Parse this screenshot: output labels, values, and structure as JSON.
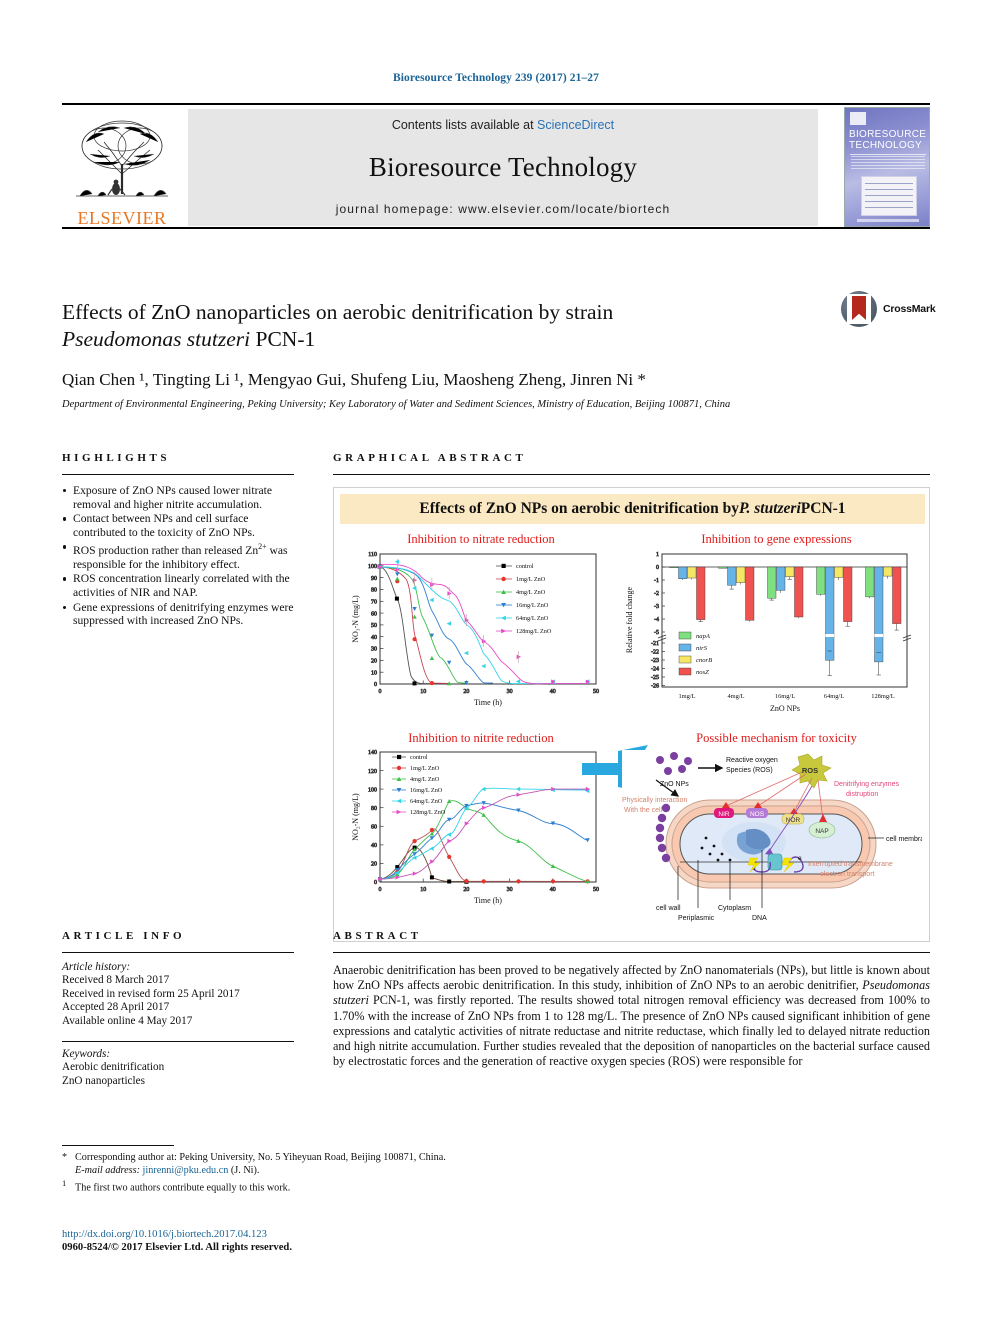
{
  "runhead": "Bioresource Technology 239 (2017) 21–27",
  "masthead": {
    "publisher": "ELSEVIER",
    "contents_prefix": "Contents lists available at ",
    "contents_link": "ScienceDirect",
    "journal_title": "Bioresource Technology",
    "homepage": "journal homepage: www.elsevier.com/locate/biortech",
    "cover_title_line1": "BIORESOURCE",
    "cover_title_line2": "TECHNOLOGY"
  },
  "article": {
    "title_line1": "Effects of ZnO nanoparticles on aerobic denitrification by strain",
    "title_line2_italic": "Pseudomonas stutzeri",
    "title_line2_rest": " PCN-1",
    "authors": "Qian Chen ¹, Tingting Li ¹, Mengyao Gui, Shufeng Liu, Maosheng Zheng, Jinren Ni *",
    "affiliation": "Department of Environmental Engineering, Peking University; Key Laboratory of Water and Sediment Sciences, Ministry of Education, Beijing 100871, China",
    "crossmark_label": "CrossMark"
  },
  "highlights": {
    "heading": "HIGHLIGHTS",
    "items": [
      "Exposure of ZnO NPs caused lower nitrate removal and higher nitrite accumulation.",
      "Contact between NPs and cell surface contributed to the toxicity of ZnO NPs.",
      "ROS production rather than released Zn2+ was responsible for the inhibitory effect.",
      "ROS concentration linearly correlated with the activities of NIR and NAP.",
      "Gene expressions of denitrifying enzymes were suppressed with increased ZnO NPs."
    ]
  },
  "graphical_abstract": {
    "heading": "GRAPHICAL ABSTRACT",
    "banner_pre": "Effects of ZnO NPs on aerobic denitrification by ",
    "banner_italic": "P. stutzeri",
    "banner_post": " PCN-1",
    "panel_titles": {
      "nitrate": "Inhibition to nitrate reduction",
      "gene": "Inhibition to gene expressions",
      "nitrite": "Inhibition to nitrite reduction",
      "mechanism": "Possible mechanism for toxicity"
    },
    "mechanism_labels": {
      "znonps": "ZnO NPs",
      "ros_long_1": "Reactive oxygen",
      "ros_long_2": "Species (ROS)",
      "ros": "ROS",
      "denit_1": "Denitrifying enzymes",
      "denit_2": "distruption",
      "phys_1": "Physically interaction",
      "phys_2": "With the cell",
      "nir": "NIR",
      "nos": "NOS",
      "nor": "NOR",
      "nap": "NAP",
      "cell_membrane": "cell membrane",
      "interrupt_1": "Interrupted transmembrane",
      "interrupt_2": "electron transport",
      "cell_wall": "cell wall",
      "periplasmic": "Periplasmic",
      "cytoplasm": "Cytoplasm",
      "dna": "DNA",
      "electron": "e"
    }
  },
  "chart_data": [
    {
      "type": "line",
      "title": "Inhibition to nitrate reduction",
      "xlabel": "Time (h)",
      "ylabel": "NO3-N (mg/L)",
      "xlim": [
        0,
        50
      ],
      "ylim": [
        0,
        110
      ],
      "xticks": [
        0,
        10,
        20,
        30,
        40,
        50
      ],
      "yticks": [
        0,
        10,
        20,
        30,
        40,
        50,
        60,
        70,
        80,
        90,
        100,
        110
      ],
      "legend_position": "top-right",
      "series": [
        {
          "name": "control",
          "color": "#000000",
          "marker": "square",
          "x": [
            0,
            4,
            8,
            12,
            16
          ],
          "y": [
            99,
            72,
            0.5,
            0.3,
            0.3
          ]
        },
        {
          "name": "1mg/L ZnO",
          "color": "#e8342a",
          "marker": "circle",
          "x": [
            0,
            4,
            8,
            12,
            16
          ],
          "y": [
            99,
            87,
            38,
            0.8,
            0.5
          ]
        },
        {
          "name": "4mg/L ZnO",
          "color": "#3fbf4a",
          "marker": "triangle-up",
          "x": [
            0,
            4,
            8,
            12,
            16,
            20
          ],
          "y": [
            99,
            89,
            57,
            22,
            1.2,
            0.6
          ]
        },
        {
          "name": "16mg/L ZnO",
          "color": "#2f7fd0",
          "marker": "triangle-down",
          "x": [
            0,
            4,
            8,
            12,
            16,
            20,
            24
          ],
          "y": [
            99,
            92,
            62,
            38,
            16.5,
            1.0,
            0.8
          ]
        },
        {
          "name": "64mg/L ZnO",
          "color": "#34d4e8",
          "marker": "triangle-left",
          "x": [
            0,
            4,
            8,
            12,
            16,
            20,
            24,
            32,
            40,
            48
          ],
          "y": [
            99,
            94,
            80,
            70,
            50,
            25,
            14,
            0.8,
            0.6,
            0.8
          ]
        },
        {
          "name": "128mg/L ZnO",
          "color": "#e64cc8",
          "marker": "triangle-right",
          "x": [
            0,
            4,
            8,
            12,
            16,
            20,
            24,
            32,
            40,
            48
          ],
          "y": [
            100,
            98,
            89,
            85,
            76,
            53,
            35,
            22,
            1.0,
            0.8
          ]
        }
      ]
    },
    {
      "type": "bar",
      "title": "Inhibition to gene expressions",
      "xlabel": "ZnO NPs",
      "ylabel": "Relative fold change",
      "categories": [
        "1mg/L",
        "4mg/L",
        "16mg/L",
        "64mg/L",
        "128mg/L"
      ],
      "yticks_upper": [
        1,
        0,
        -1,
        -2,
        -3,
        -4,
        -5
      ],
      "yticks_lower": [
        -21,
        -22,
        -23,
        -24,
        -25,
        -26
      ],
      "axis_break": true,
      "series": [
        {
          "name": "napA",
          "color": "#7ee07e",
          "values": [
            -0.05,
            -0.1,
            -2.4,
            -2.1,
            -2.3
          ],
          "errors": [
            0.05,
            0.05,
            0.15,
            0.1,
            0.15
          ]
        },
        {
          "name": "nirS",
          "color": "#66b3e8",
          "values": [
            -0.9,
            -1.4,
            -1.8,
            -23.2,
            -23.4
          ],
          "errors": [
            0.1,
            0.3,
            0.2,
            1.8,
            1.6
          ]
        },
        {
          "name": "cnorB",
          "color": "#f5e663",
          "values": [
            -0.85,
            -1.2,
            -0.75,
            -0.8,
            -0.7
          ],
          "errors": [
            0.1,
            0.15,
            0.2,
            0.2,
            0.15
          ]
        },
        {
          "name": "nosZ",
          "color": "#f0534f",
          "values": [
            -4.05,
            -4.1,
            -3.85,
            -4.2,
            -4.35
          ],
          "errors": [
            0.15,
            0.1,
            0.1,
            0.35,
            0.5
          ]
        }
      ]
    },
    {
      "type": "line",
      "title": "Inhibition to nitrite reduction",
      "xlabel": "Time (h)",
      "ylabel": "NO2-N (mg/L)",
      "xlim": [
        0,
        50
      ],
      "ylim": [
        0,
        140
      ],
      "xticks": [
        0,
        10,
        20,
        30,
        40,
        50
      ],
      "yticks": [
        0,
        20,
        40,
        60,
        80,
        100,
        120,
        140
      ],
      "legend_position": "top-left",
      "series": [
        {
          "name": "control",
          "color": "#000000",
          "marker": "square",
          "x": [
            0,
            4,
            8,
            12,
            16,
            20,
            24
          ],
          "y": [
            3,
            16,
            37,
            5,
            1,
            0.5,
            0.5
          ]
        },
        {
          "name": "1mg/L ZnO",
          "color": "#e8342a",
          "marker": "circle",
          "x": [
            0,
            4,
            8,
            12,
            16,
            20,
            24,
            32,
            40,
            48
          ],
          "y": [
            3,
            11,
            44,
            56,
            27,
            1,
            0.5,
            0.5,
            0.5,
            0.5
          ]
        },
        {
          "name": "4mg/L ZnO",
          "color": "#3fbf4a",
          "marker": "triangle-up",
          "x": [
            0,
            4,
            8,
            12,
            16,
            20,
            24,
            32,
            40,
            48
          ],
          "y": [
            3,
            8,
            35,
            52,
            87,
            80,
            72,
            44,
            17,
            1
          ]
        },
        {
          "name": "16mg/L ZnO",
          "color": "#2f7fd0",
          "marker": "triangle-down",
          "x": [
            0,
            4,
            8,
            12,
            16,
            20,
            24,
            32,
            40,
            48
          ],
          "y": [
            3,
            13,
            30,
            47,
            67,
            82,
            85,
            77,
            63,
            45
          ]
        },
        {
          "name": "64mg/L ZnO",
          "color": "#34d4e8",
          "marker": "triangle-left",
          "x": [
            0,
            4,
            8,
            12,
            16,
            20,
            24,
            32,
            40,
            48
          ],
          "y": [
            3,
            10,
            26,
            36,
            51,
            79,
            100,
            100,
            99,
            98
          ]
        },
        {
          "name": "128mg/L ZnO",
          "color": "#e64cc8",
          "marker": "triangle-right",
          "x": [
            0,
            4,
            8,
            12,
            16,
            20,
            24,
            32,
            40,
            48
          ],
          "y": [
            3,
            5,
            9,
            22,
            44,
            63,
            80,
            94,
            100,
            100
          ]
        }
      ]
    }
  ],
  "article_info": {
    "heading": "ARTICLE INFO",
    "history_label": "Article history:",
    "history": [
      "Received 8 March 2017",
      "Received in revised form 25 April 2017",
      "Accepted 28 April 2017",
      "Available online 4 May 2017"
    ],
    "keywords_label": "Keywords:",
    "keywords": [
      "Aerobic denitrification",
      "ZnO nanoparticles"
    ]
  },
  "abstract": {
    "heading": "ABSTRACT",
    "part1": "Anaerobic denitrification has been proved to be negatively affected by ZnO nanomaterials (NPs), but little is known about how ZnO NPs affects aerobic denitrification. In this study, inhibition of ZnO NPs to an aerobic denitrifier, ",
    "italic": "Pseudomonas stutzeri",
    "part2": " PCN-1, was firstly reported. The results showed total nitrogen removal efficiency was decreased from 100% to 1.70% with the increase of ZnO NPs from 1 to 128 mg/L. The presence of ZnO NPs caused significant inhibition of gene expressions and catalytic activities of nitrate reductase and nitrite reductase, which finally led to delayed nitrate reduction and high nitrite accumulation. Further studies revealed that the deposition of nanoparticles on the bacterial surface caused by electrostatic forces and the generation of reactive oxygen species (ROS) were responsible for"
  },
  "footnotes": {
    "corresponding": "Corresponding author at: Peking University, No. 5 Yiheyuan Road, Beijing 100871, China.",
    "email_label": "E-mail address:",
    "email": "jinrenni@pku.edu.cn",
    "email_suffix": " (J. Ni).",
    "equal_contribution": "The first two authors contribute equally to this work.",
    "doi": "http://dx.doi.org/10.1016/j.biortech.2017.04.123",
    "copyright": "0960-8524/© 2017 Elsevier Ltd. All rights reserved."
  }
}
